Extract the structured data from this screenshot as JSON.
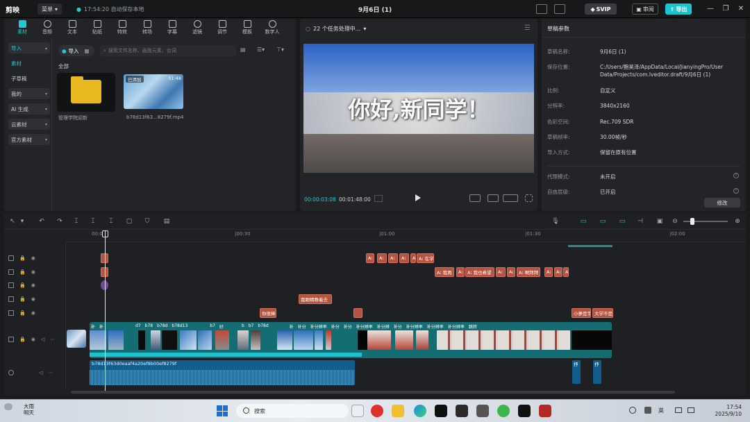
{
  "app": {
    "logo": "剪映",
    "menu_label": "菜单",
    "autosave": "17:54:20 自动保存本地",
    "project_title": "9月6日 (1)",
    "svip_label": "SVIP",
    "review_label": "审阅",
    "export_label": "导出"
  },
  "media": {
    "tabs": [
      {
        "label": "素材"
      },
      {
        "label": "音频"
      },
      {
        "label": "文本"
      },
      {
        "label": "贴纸"
      },
      {
        "label": "特效"
      },
      {
        "label": "转场"
      },
      {
        "label": "字幕"
      },
      {
        "label": "滤镜"
      },
      {
        "label": "调节"
      },
      {
        "label": "模板"
      },
      {
        "label": "数字人"
      }
    ],
    "sidebar": [
      {
        "label": "导入"
      },
      {
        "label": "素材"
      },
      {
        "label": "子草稿"
      },
      {
        "label": "我的"
      },
      {
        "label": "AI 生成"
      },
      {
        "label": "云素材"
      },
      {
        "label": "官方素材"
      }
    ],
    "import_label": "导入",
    "search_placeholder": "搜索文件名称、画面元素、台词",
    "all_label": "全部",
    "folder_name": "管理学院迎新",
    "clip_tag": "已添加",
    "clip_duration": "01:48",
    "clip_name": "b78d13f63...8279f.mp4"
  },
  "player": {
    "status": "22 个任务处理中...",
    "caption": "你好,新同学！",
    "time_current": "00:00:03:08",
    "time_total": "00:01:48:00"
  },
  "params": {
    "title": "草稿参数",
    "rows": [
      {
        "label": "草稿名称:",
        "value": "9月6日 (1)"
      },
      {
        "label": "保存位置:",
        "value": "C:/Users/鲍昊泽/AppData/Local/JianyingPro/User Data/Projects/com.lveditor.draft/9月6日 (1)"
      },
      {
        "label": "比例:",
        "value": "自定义"
      },
      {
        "label": "分辨率:",
        "value": "3840x2160"
      },
      {
        "label": "色彩空间:",
        "value": "Rec.709 SDR"
      },
      {
        "label": "草稿帧率:",
        "value": "30.00帧/秒"
      },
      {
        "label": "导入方式:",
        "value": "保留在原有位置"
      },
      {
        "label": "代理模式:",
        "value": "未开启"
      },
      {
        "label": "自由层级:",
        "value": "已开启"
      }
    ],
    "modify_label": "修改"
  },
  "timeline": {
    "ruler": [
      "00:00",
      "|00:30",
      "|01:00",
      "|01:30",
      "|02:00"
    ],
    "text_clips_row3": [
      "A⁝",
      "A⁝",
      "A⁝",
      "A⁝",
      "A⁝",
      "A⁝ 在学"
    ],
    "text_clips_row4": [
      "A⁝ 我再",
      "A⁝",
      "A⁝ 我也希望",
      "A⁝",
      "A⁝",
      "A⁝ 啊拜拜",
      "A⁝",
      "A⁝",
      "A⁝"
    ],
    "text_clip_row6": "我眼睛睁着去",
    "text_clip_row7a": "你很棒",
    "text_clip_row7b": "小夢是宇",
    "text_clip_row7c": "大学不是",
    "main_labels": [
      "补",
      "补",
      "d7",
      "b78",
      "b78d",
      "b78d13",
      "b7",
      "好",
      "b",
      "b7",
      "b78d",
      "补",
      "补分",
      "补分辨率",
      "补分",
      "补分",
      "补分辨率",
      "补分辨",
      "补分",
      "补分辨率",
      "补分辨率",
      "补分辨率",
      "跳转"
    ],
    "audio_name": "b78d13f63d0eaaf4a20ef9b00ef8279f",
    "audio_small_a": "抒",
    "audio_small_b": "抒"
  },
  "taskbar": {
    "weather_temp": "大雨",
    "weather_desc": "明天",
    "search_label": "搜索",
    "ime": "英",
    "time": "17:54",
    "date": "2025/9/10"
  }
}
